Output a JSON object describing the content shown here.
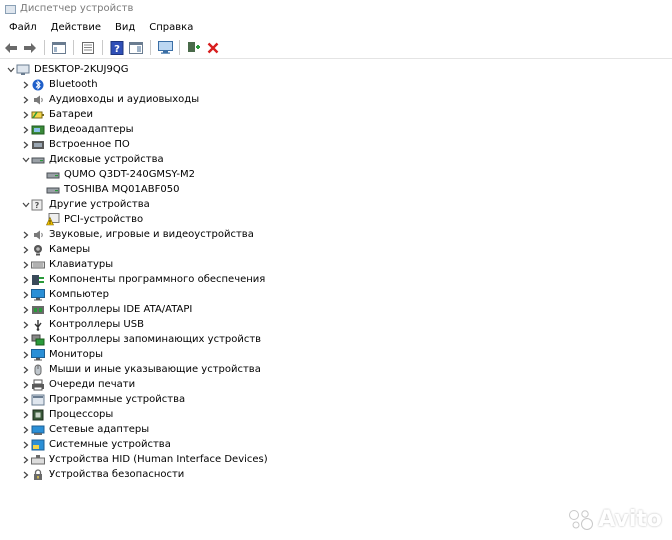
{
  "window": {
    "title": "Диспетчер устройств"
  },
  "menu": [
    "Файл",
    "Действие",
    "Вид",
    "Справка"
  ],
  "tree": {
    "root": "DESKTOP-2KUJ9QG",
    "categories": [
      {
        "label": "Bluetooth",
        "icon": "bluetooth-icon",
        "expanded": false
      },
      {
        "label": "Аудиовходы и аудиовыходы",
        "icon": "speaker-icon",
        "expanded": false
      },
      {
        "label": "Батареи",
        "icon": "battery-icon",
        "expanded": false
      },
      {
        "label": "Видеоадаптеры",
        "icon": "display-adapter-icon",
        "expanded": false
      },
      {
        "label": "Встроенное ПО",
        "icon": "firmware-icon",
        "expanded": false
      },
      {
        "label": "Дисковые устройства",
        "icon": "disk-drive-icon",
        "expanded": true,
        "children": [
          {
            "label": "QUMO Q3DT-240GMSY-M2",
            "icon": "disk-drive-icon"
          },
          {
            "label": "TOSHIBA MQ01ABF050",
            "icon": "disk-drive-icon"
          }
        ]
      },
      {
        "label": "Другие устройства",
        "icon": "unknown-device-icon",
        "expanded": true,
        "children": [
          {
            "label": "PCI-устройство",
            "icon": "warning-device-icon"
          }
        ]
      },
      {
        "label": "Звуковые, игровые и видеоустройства",
        "icon": "speaker-icon",
        "expanded": false
      },
      {
        "label": "Камеры",
        "icon": "camera-icon",
        "expanded": false
      },
      {
        "label": "Клавиатуры",
        "icon": "keyboard-icon",
        "expanded": false
      },
      {
        "label": "Компоненты программного обеспечения",
        "icon": "software-component-icon",
        "expanded": false
      },
      {
        "label": "Компьютер",
        "icon": "monitor-icon",
        "expanded": false
      },
      {
        "label": "Контроллеры IDE ATA/ATAPI",
        "icon": "ide-controller-icon",
        "expanded": false
      },
      {
        "label": "Контроллеры USB",
        "icon": "usb-icon",
        "expanded": false
      },
      {
        "label": "Контроллеры запоминающих устройств",
        "icon": "storage-controller-icon",
        "expanded": false
      },
      {
        "label": "Мониторы",
        "icon": "monitor-icon",
        "expanded": false
      },
      {
        "label": "Мыши и иные указывающие устройства",
        "icon": "mouse-icon",
        "expanded": false
      },
      {
        "label": "Очереди печати",
        "icon": "printer-icon",
        "expanded": false
      },
      {
        "label": "Программные устройства",
        "icon": "software-device-icon",
        "expanded": false
      },
      {
        "label": "Процессоры",
        "icon": "processor-icon",
        "expanded": false
      },
      {
        "label": "Сетевые адаптеры",
        "icon": "network-adapter-icon",
        "expanded": false
      },
      {
        "label": "Системные устройства",
        "icon": "system-device-icon",
        "expanded": false
      },
      {
        "label": "Устройства HID (Human Interface Devices)",
        "icon": "hid-icon",
        "expanded": false
      },
      {
        "label": "Устройства безопасности",
        "icon": "security-device-icon",
        "expanded": false
      }
    ]
  },
  "watermark": {
    "text": "Avito"
  },
  "colors": {
    "accent": "#2b6fd4",
    "remove": "#d81e1e",
    "add": "#2a9a3a"
  }
}
